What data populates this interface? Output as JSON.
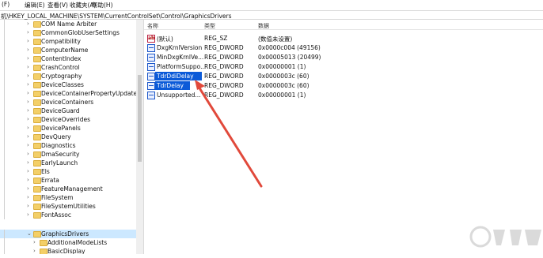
{
  "menubar": {
    "items": [
      "(F)",
      "编辑(E)",
      "查看(V)",
      "收藏夹(A)",
      "帮助(H)"
    ]
  },
  "addressbar": {
    "path": "机\\HKEY_LOCAL_MACHINE\\SYSTEM\\CurrentControlSet\\Control\\GraphicsDrivers"
  },
  "tree": {
    "items": [
      "COM Name Arbiter",
      "CommonGlobUserSettings",
      "Compatibility",
      "ComputerName",
      "ContentIndex",
      "CrashControl",
      "Cryptography",
      "DeviceClasses",
      "DeviceContainerPropertyUpdateEve",
      "DeviceContainers",
      "DeviceGuard",
      "DeviceOverrides",
      "DevicePanels",
      "DevQuery",
      "Diagnostics",
      "DmaSecurity",
      "EarlyLaunch",
      "Els",
      "Errata",
      "FeatureManagement",
      "FileSystem",
      "FileSystemUtilities",
      "FontAssoc",
      "GraphicsDrivers",
      "AdditionalModeLists",
      "BasicDisplay"
    ]
  },
  "list": {
    "headers": {
      "name": "名称",
      "type": "类型",
      "data": "数据"
    },
    "rows": [
      {
        "name": "(默认)",
        "type": "REG_SZ",
        "data": "(数值未设置)",
        "icon": "string-value-icon"
      },
      {
        "name": "DxgKrnlVersion",
        "type": "REG_DWORD",
        "data": "0x0000c004 (49156)",
        "icon": "binary-value-icon"
      },
      {
        "name": "MinDxgKrnlVe...",
        "type": "REG_DWORD",
        "data": "0x00005013 (20499)",
        "icon": "binary-value-icon"
      },
      {
        "name": "PlatformSuppo...",
        "type": "REG_DWORD",
        "data": "0x00000001 (1)",
        "icon": "binary-value-icon"
      },
      {
        "name": "TdrDdiDelay",
        "type": "REG_DWORD",
        "data": "0x0000003c (60)",
        "icon": "binary-value-icon"
      },
      {
        "name": "TdrDelay",
        "type": "REG_DWORD",
        "data": "0x0000003c (60)",
        "icon": "binary-value-icon"
      },
      {
        "name": "Unsupported...",
        "type": "REG_DWORD",
        "data": "0x00000001 (1)",
        "icon": "binary-value-icon"
      }
    ]
  },
  "colors": {
    "selection": "#0b5ad8",
    "tree_selection": "#cce8ff",
    "annotation_arrow": "#e1493b"
  }
}
